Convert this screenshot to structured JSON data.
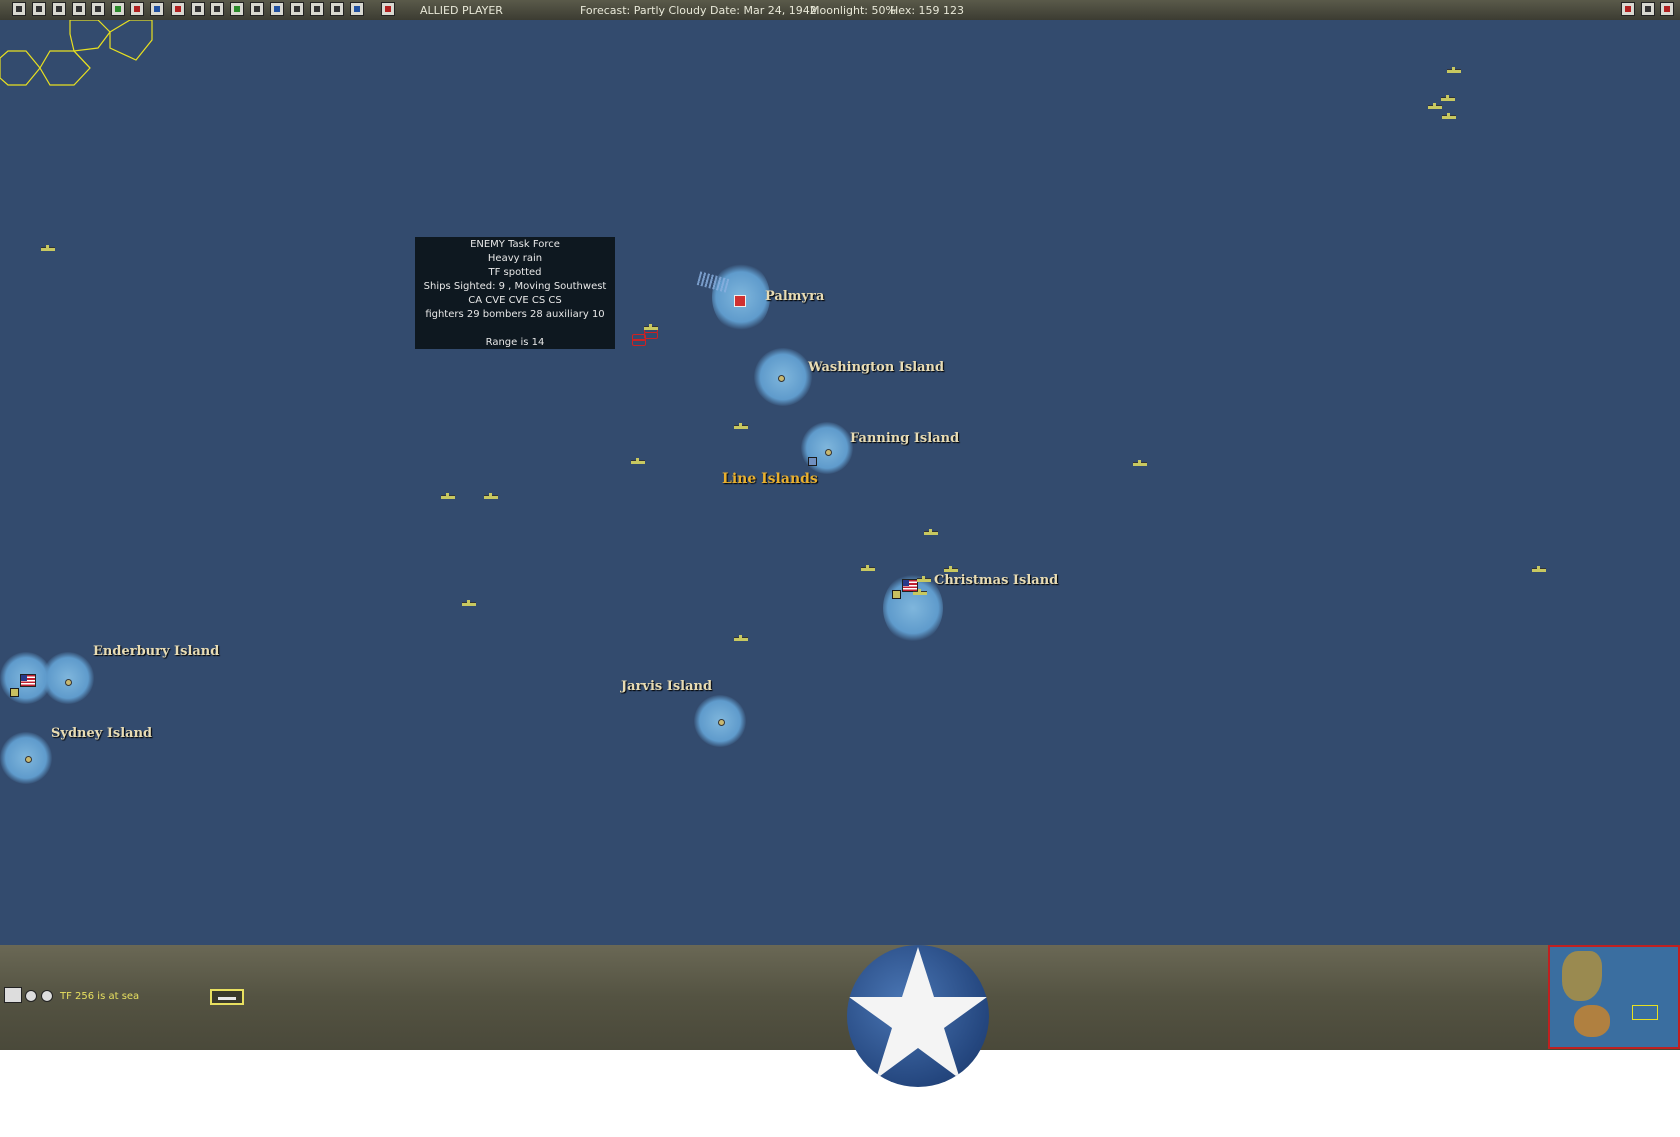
{
  "toolbar": {
    "player": "ALLIED PLAYER",
    "forecast": "Forecast: Partly Cloudy",
    "date": "Date: Mar 24, 1942",
    "moonlight": "Moonlight: 50%",
    "hex": "Hex: 159 123",
    "left_icons": [
      "save-icon",
      "report-icon",
      "list-icon",
      "list-icon",
      "info-icon",
      "star-icon",
      "target-icon",
      "cross-icon",
      "flag-icon",
      "ship-icon",
      "ship-icon",
      "chart-icon",
      "ship-icon",
      "globe-icon",
      "list-icon",
      "info-icon",
      "list-icon",
      "cloud-icon",
      "play-icon"
    ],
    "right_icons": [
      "flag-icon",
      "code-icon",
      "close-icon"
    ]
  },
  "map": {
    "islands": [
      {
        "id": "palmyra",
        "name": "Palmyra"
      },
      {
        "id": "washington",
        "name": "Washington Island"
      },
      {
        "id": "fanning",
        "name": "Fanning Island"
      },
      {
        "id": "christmas",
        "name": "Christmas Island"
      },
      {
        "id": "enderbury",
        "name": "Enderbury Island"
      },
      {
        "id": "jarvis",
        "name": "Jarvis Island"
      },
      {
        "id": "sydney",
        "name": "Sydney Island"
      }
    ],
    "region_label": "Line Islands",
    "colors": {
      "ocean": "#334b6e",
      "shallows": "#6fa9d6",
      "friendly": "#c8c860",
      "enemy": "#d02020",
      "hex_grid": "#e8e020"
    }
  },
  "tooltip": {
    "lines": [
      "ENEMY Task Force",
      "Heavy rain",
      "TF spotted",
      "Ships Sighted: 9 , Moving Southwest",
      "CA CVE CVE CS CS",
      "fighters 29  bombers 28  auxiliary 10",
      "",
      "Range is 14"
    ]
  },
  "bottom": {
    "status": "TF 256 is at sea"
  }
}
